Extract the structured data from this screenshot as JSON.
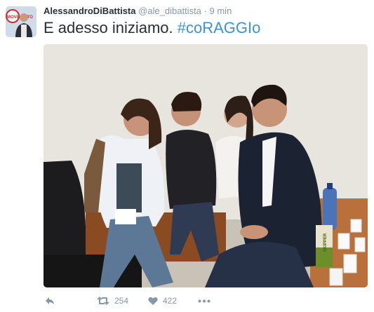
{
  "tweet": {
    "author_name": "AlessandroDiBattista",
    "author_handle": "@ale_dibattista",
    "separator": "·",
    "time": "9 min",
    "text_plain": "E adesso iniziamo. ",
    "hashtag": "#coRAGGIo"
  },
  "avatar": {
    "logo_text": "MOVIMENTO"
  },
  "photo": {
    "bottle_label": "SKIPPER"
  },
  "actions": {
    "retweet_count": "254",
    "like_count": "422"
  },
  "colors": {
    "link": "#3b94d9",
    "muted": "#8899a6",
    "text": "#292f33"
  },
  "icons": [
    "reply-icon",
    "retweet-icon",
    "like-icon",
    "more-icon"
  ]
}
